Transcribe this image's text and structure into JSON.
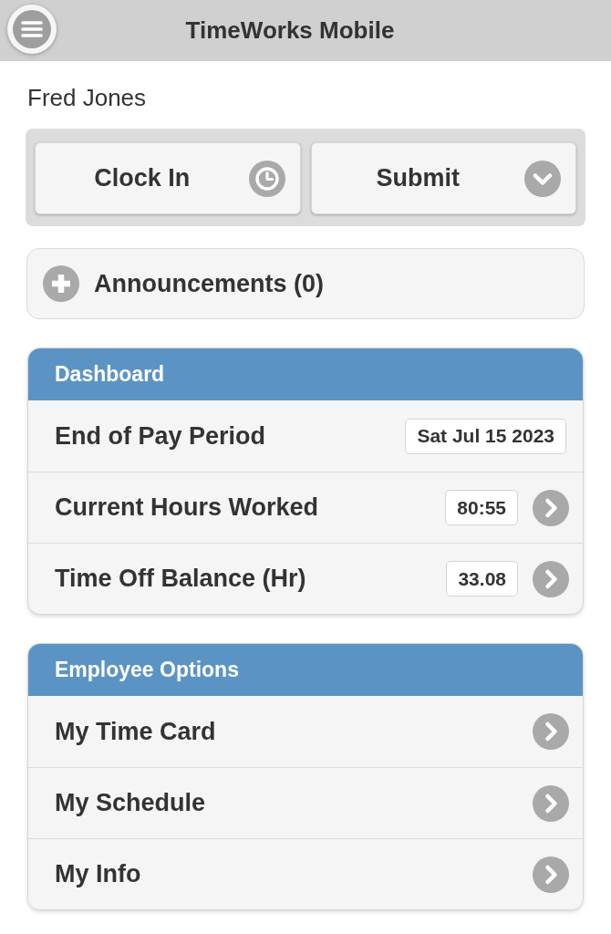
{
  "header": {
    "title": "TimeWorks Mobile"
  },
  "user": {
    "name": "Fred Jones"
  },
  "clock_in_button": {
    "label": "Clock In"
  },
  "submit_menu": {
    "label": "Submit"
  },
  "announcements": {
    "label": "Announcements (0)",
    "expanded": false
  },
  "dashboard": {
    "title": "Dashboard",
    "rows": [
      {
        "kind": "static",
        "label": "End of Pay Period",
        "value": "Sat Jul 15 2023"
      },
      {
        "kind": "link",
        "label": "Current Hours Worked",
        "value": "80:55"
      },
      {
        "kind": "link",
        "label": "Time Off Balance (Hr)",
        "value": "33.08"
      }
    ]
  },
  "employee_options": {
    "title": "Employee Options",
    "items": [
      {
        "label": "My Time Card"
      },
      {
        "label": "My Schedule"
      },
      {
        "label": "My Info"
      }
    ]
  }
}
